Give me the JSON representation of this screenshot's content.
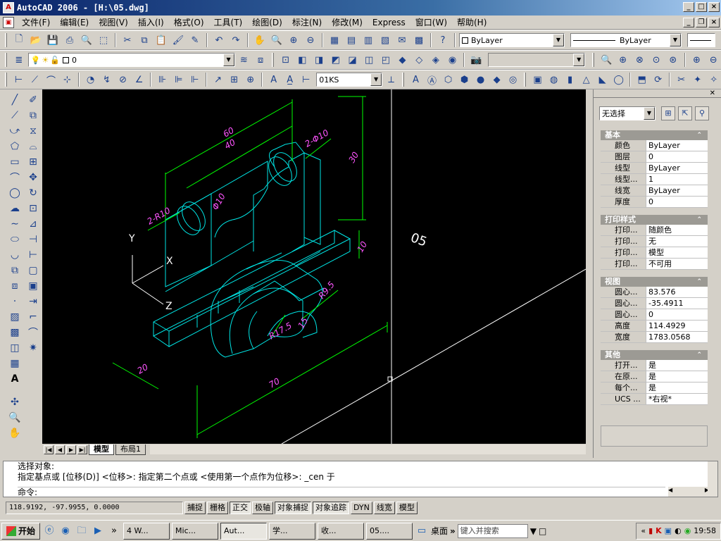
{
  "window": {
    "title": "AutoCAD 2006 - [H:\\05.dwg]",
    "app_badge": "A"
  },
  "menu": [
    "文件(F)",
    "编辑(E)",
    "视图(V)",
    "插入(I)",
    "格式(O)",
    "工具(T)",
    "绘图(D)",
    "标注(N)",
    "修改(M)",
    "Express",
    "窗口(W)",
    "帮助(H)"
  ],
  "toolbar": {
    "color_value": "ByLayer",
    "linetype_value": "ByLayer",
    "layer_value": "0",
    "dimstyle_value": "01KS"
  },
  "drawing": {
    "dims": {
      "d60": "60",
      "d40": "40",
      "d2phi10": "2-Φ10",
      "d30": "30",
      "d2r10": "2-R10",
      "dphi10": "Φ10",
      "d05": "05",
      "d10": "10",
      "d20": "20",
      "d70": "70",
      "dr175": "R17.5",
      "dr95": "R9.5",
      "d15": "15"
    },
    "axes": {
      "y": "Y",
      "x": "X",
      "z": "Z"
    }
  },
  "layout_tabs": {
    "model": "模型",
    "layout1": "布局1"
  },
  "properties": {
    "selection": "无选择",
    "sections": {
      "basic": {
        "title": "基本",
        "rows": [
          {
            "k": "颜色",
            "v": "ByLayer"
          },
          {
            "k": "图层",
            "v": "0"
          },
          {
            "k": "线型",
            "v": "ByLayer"
          },
          {
            "k": "线型...",
            "v": "1"
          },
          {
            "k": "线宽",
            "v": "ByLayer"
          },
          {
            "k": "厚度",
            "v": "0"
          }
        ]
      },
      "plot": {
        "title": "打印样式",
        "rows": [
          {
            "k": "打印...",
            "v": "随颜色"
          },
          {
            "k": "打印...",
            "v": "无"
          },
          {
            "k": "打印...",
            "v": "模型"
          },
          {
            "k": "打印...",
            "v": "不可用"
          }
        ]
      },
      "view": {
        "title": "视图",
        "rows": [
          {
            "k": "圆心...",
            "v": "83.576"
          },
          {
            "k": "圆心...",
            "v": "-35.4911"
          },
          {
            "k": "圆心...",
            "v": "0"
          },
          {
            "k": "高度",
            "v": "114.4929"
          },
          {
            "k": "宽度",
            "v": "1783.0568"
          }
        ]
      },
      "misc": {
        "title": "其他",
        "rows": [
          {
            "k": "打开...",
            "v": "是"
          },
          {
            "k": "在原...",
            "v": "是"
          },
          {
            "k": "每个...",
            "v": "是"
          },
          {
            "k": "UCS ...",
            "v": "*右视*"
          }
        ]
      }
    }
  },
  "command": {
    "line1": "选择对象:",
    "line2": "指定基点或 [位移(D)] <位移>:  指定第二个点或 <使用第一个点作为位移>: _cen 于",
    "prompt": "命令:"
  },
  "status": {
    "coords": "118.9192, -97.9955, 0.0000",
    "buttons": [
      {
        "label": "捕捉",
        "on": false
      },
      {
        "label": "栅格",
        "on": false
      },
      {
        "label": "正交",
        "on": true
      },
      {
        "label": "极轴",
        "on": false
      },
      {
        "label": "对象捕捉",
        "on": true
      },
      {
        "label": "对象追踪",
        "on": true
      },
      {
        "label": "DYN",
        "on": false
      },
      {
        "label": "线宽",
        "on": false
      },
      {
        "label": "模型",
        "on": false
      }
    ]
  },
  "taskbar": {
    "start": "开始",
    "tasks": [
      "4 W...",
      "Mic...",
      "Aut...",
      "学...",
      "收...",
      "05...."
    ],
    "desktop": "桌面",
    "search_placeholder": "键入并搜索",
    "clock": "19:58"
  }
}
